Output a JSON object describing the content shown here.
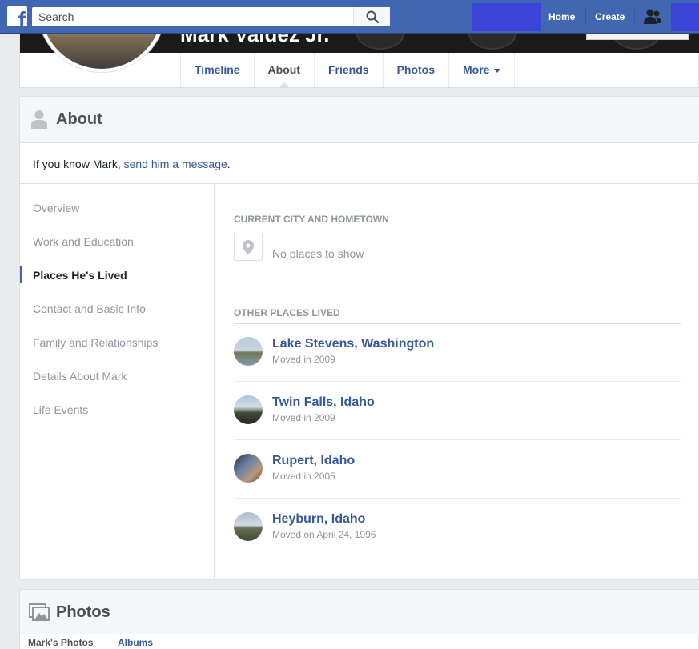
{
  "topbar": {
    "logo": "f",
    "search_placeholder": "Search",
    "nav": {
      "home": "Home",
      "create": "Create"
    },
    "icons": [
      "search-icon",
      "friends-icon"
    ],
    "brand_color": "#4267b2"
  },
  "profile": {
    "name": "Mark Valdez Jr.",
    "tabs": [
      {
        "label": "Timeline"
      },
      {
        "label": "About"
      },
      {
        "label": "Friends"
      },
      {
        "label": "Photos"
      },
      {
        "label": "More"
      }
    ]
  },
  "about": {
    "title": "About",
    "message_prefix": "If you know Mark, ",
    "message_link": "send him a message",
    "message_suffix": ".",
    "sidebar": [
      {
        "label": "Overview"
      },
      {
        "label": "Work and Education"
      },
      {
        "label": "Places He's Lived"
      },
      {
        "label": "Contact and Basic Info"
      },
      {
        "label": "Family and Relationships"
      },
      {
        "label": "Details About Mark"
      },
      {
        "label": "Life Events"
      }
    ],
    "current_section": {
      "title": "CURRENT CITY AND HOMETOWN",
      "empty_text": "No places to show"
    },
    "other_section": {
      "title": "OTHER PLACES LIVED",
      "places": [
        {
          "name": "Lake Stevens, Washington",
          "moved": "Moved in 2009"
        },
        {
          "name": "Twin Falls, Idaho",
          "moved": "Moved in 2009"
        },
        {
          "name": "Rupert, Idaho",
          "moved": "Moved in 2005"
        },
        {
          "name": "Heyburn, Idaho",
          "moved": "Moved on April 24, 1996"
        }
      ]
    }
  },
  "photos": {
    "title": "Photos",
    "tabs": [
      {
        "label": "Mark's Photos"
      },
      {
        "label": "Albums"
      }
    ]
  }
}
